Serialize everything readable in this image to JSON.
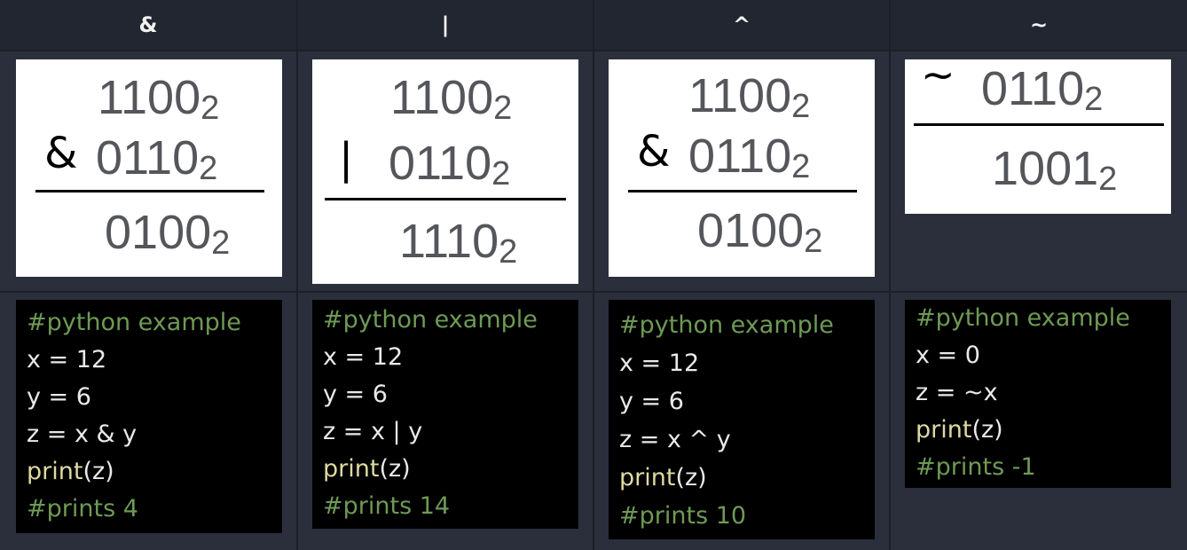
{
  "headers": [
    "&",
    "|",
    "^",
    "~"
  ],
  "columns": [
    {
      "operator": "&",
      "operand_a": "1100",
      "operand_b": "0110",
      "result": "0100",
      "base": "2",
      "code": {
        "comment": "#python example",
        "line_x": "x = 12",
        "line_y": "y = 6",
        "line_z": "z = x & y",
        "print_fn": "print",
        "print_arg": "(z)",
        "output": "#prints 4"
      }
    },
    {
      "operator": "|",
      "operand_a": "1100",
      "operand_b": "0110",
      "result": "1110",
      "base": "2",
      "code": {
        "comment": "#python example",
        "line_x": "x = 12",
        "line_y": "y = 6",
        "line_z": "z = x | y",
        "print_fn": "print",
        "print_arg": "(z)",
        "output": "#prints 14"
      }
    },
    {
      "operator": "&",
      "operand_a": "1100",
      "operand_b": "0110",
      "result": "0100",
      "base": "2",
      "code": {
        "comment": "#python example",
        "line_x": "x = 12",
        "line_y": "y = 6",
        "line_z": "z = x ^ y",
        "print_fn": "print",
        "print_arg": "(z)",
        "output": "#prints 10"
      }
    },
    {
      "operator": "~",
      "operand_b": "0110",
      "result": "1001",
      "base": "2",
      "code": {
        "comment": "#python example",
        "line_x": "x = 0",
        "line_z": "z = ~x",
        "print_fn": "print",
        "print_arg": "(z)",
        "output": "#prints -1"
      }
    }
  ],
  "colors": {
    "header_bg": "#222631",
    "row_bg": "#2a2f3b",
    "comment": "#6e9a55",
    "code_text": "#e9e9e9",
    "function": "#ded9a2"
  }
}
